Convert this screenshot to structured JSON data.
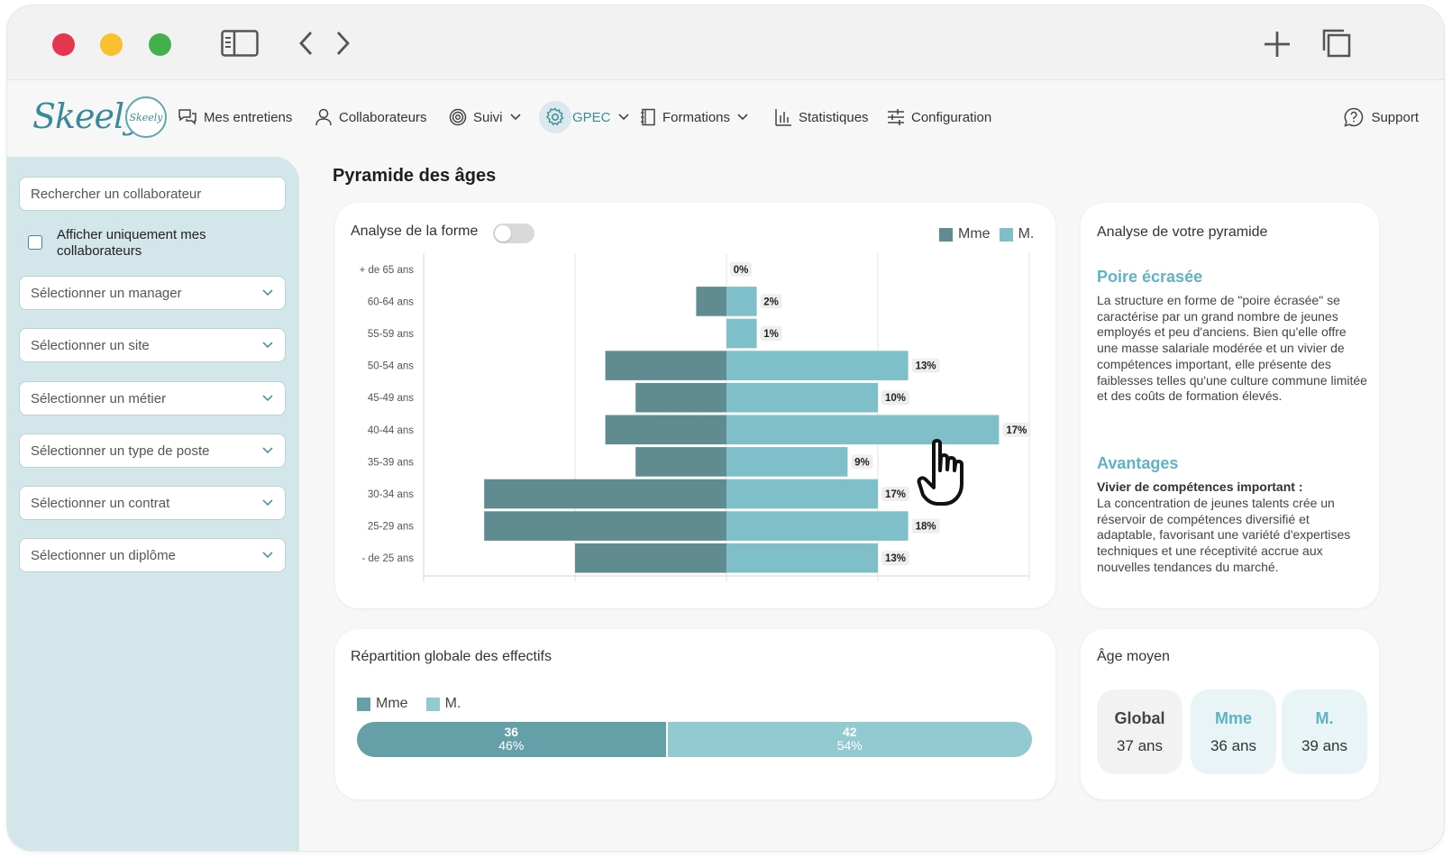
{
  "nav": {
    "logo": "Skeely",
    "badge": "Skeely",
    "items": [
      {
        "label": "Mes entretiens",
        "icon": "chat-icon"
      },
      {
        "label": "Collaborateurs",
        "icon": "user-icon"
      },
      {
        "label": "Suivi",
        "icon": "target-icon"
      },
      {
        "label": "GPEC",
        "icon": "gear-icon"
      },
      {
        "label": "Formations",
        "icon": "notebook-icon"
      },
      {
        "label": "Statistiques",
        "icon": "bar-chart-icon"
      },
      {
        "label": "Configuration",
        "icon": "sliders-icon"
      }
    ],
    "support": "Support"
  },
  "sidebar": {
    "search_placeholder": "Rechercher un collaborateur",
    "checkbox_label": "Afficher uniquement mes collaborateurs",
    "selects": [
      "Sélectionner un manager",
      "Sélectionner un site",
      "Sélectionner un métier",
      "Sélectionner un type de poste",
      "Sélectionner un contrat",
      "Sélectionner un diplôme"
    ]
  },
  "main": {
    "title": "Pyramide des âges",
    "pyramid_card": {
      "toggle_label": "Analyse de la forme",
      "legend": [
        "Mme",
        "M."
      ]
    },
    "analysis": {
      "title": "Analyse de votre pyramide",
      "shape_title": "Poire écrasée",
      "shape_text": "La structure en forme de \"poire écrasée\" se caractérise par un grand nombre de jeunes employés et peu d'anciens. Bien qu'elle offre une masse salariale modérée et un vivier de compétences important, elle présente des faiblesses telles qu'une culture commune limitée et des coûts de formation élevés.",
      "advantages_title": "Avantages",
      "advantage_subtitle": "Vivier de compétences important :",
      "advantage_text": "La concentration de jeunes talents crée un réservoir de compétences diversifié et adaptable, favorisant une variété d'expertises techniques et une réceptivité accrue aux nouvelles tendances du marché."
    },
    "repartition": {
      "title": "Répartition globale des effectifs",
      "legend": [
        "Mme",
        "M."
      ],
      "mme": {
        "count": "36",
        "pct": "46%"
      },
      "m": {
        "count": "42",
        "pct": "54%"
      }
    },
    "age": {
      "title": "Âge moyen",
      "boxes": [
        {
          "label": "Global",
          "value": "37 ans"
        },
        {
          "label": "Mme",
          "value": "36 ans"
        },
        {
          "label": "M.",
          "value": "39 ans"
        }
      ]
    }
  },
  "colors": {
    "mme": "#5f8b91",
    "m": "#7ebfca",
    "accent": "#5fb3c4",
    "sidebar": "#d3e6ea"
  },
  "chart_data": {
    "type": "bar",
    "orientation": "horizontal-pyramid",
    "categories": [
      "+ de 65 ans",
      "60-64 ans",
      "55-59 ans",
      "50-54 ans",
      "45-49 ans",
      "40-44 ans",
      "35-39 ans",
      "30-34 ans",
      "25-29 ans",
      "- de 25 ans"
    ],
    "series": [
      {
        "name": "Mme",
        "values": [
          0,
          2,
          0,
          8,
          6,
          8,
          6,
          16,
          16,
          10
        ]
      },
      {
        "name": "M.",
        "values": [
          0,
          2,
          2,
          12,
          10,
          18,
          8,
          10,
          12,
          10
        ]
      }
    ],
    "data_labels": [
      "0%",
      "2%",
      "1%",
      "13%",
      "10%",
      "17%",
      "9%",
      "17%",
      "18%",
      "13%"
    ],
    "xlim": [
      -20,
      20
    ],
    "grid": true,
    "legend": "top-right"
  }
}
